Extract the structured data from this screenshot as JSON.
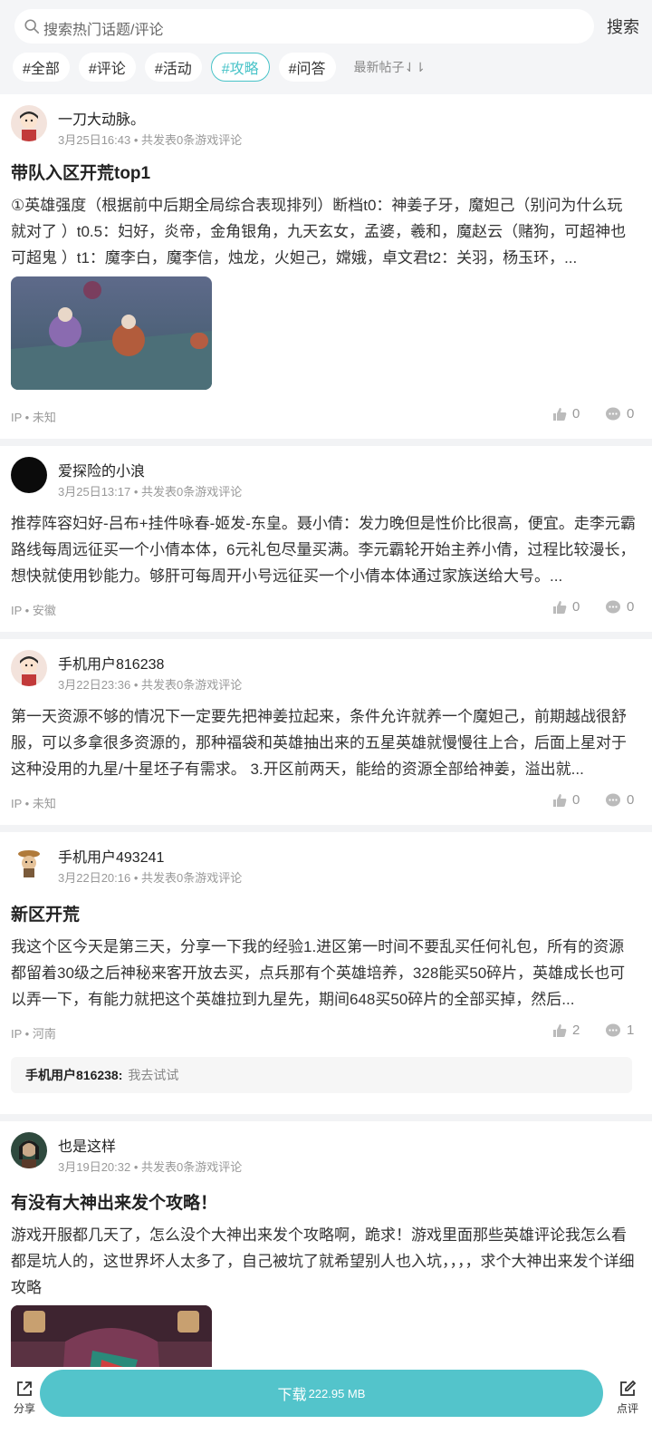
{
  "search": {
    "placeholder": "搜索热门话题/评论",
    "button": "搜索"
  },
  "filters": [
    {
      "label": "#全部"
    },
    {
      "label": "#评论"
    },
    {
      "label": "#活动"
    },
    {
      "label": "#攻略",
      "active": true
    },
    {
      "label": "#问答"
    }
  ],
  "sort_label": "最新帖子⇃⇂",
  "posts": [
    {
      "user": "一刀大动脉。",
      "meta": "3月25日16:43 • 共发表0条游戏评论",
      "title": "带队入区开荒top1",
      "body": "①英雄强度（根据前中后期全局综合表现排列）断档t0：神姜子牙，魔妲己（别问为什么玩就对了 ）t0.5：妇好，炎帝，金角银角，九天玄女，孟婆，羲和，魔赵云（赌狗，可超神也可超鬼 ）t1：魔李白，魔李信，烛龙，火妲己，嫦娥，卓文君t2：关羽，杨玉环，...",
      "ip": "IP • 未知",
      "likes": "0",
      "comments": "0"
    },
    {
      "user": "爱探险的小浪",
      "meta": "3月25日13:17 • 共发表0条游戏评论",
      "body": "推荐阵容妇好-吕布+挂件咏春-姬发-东皇。聂小倩：发力晚但是性价比很高，便宜。走李元霸路线每周远征买一个小倩本体，6元礼包尽量买满。李元霸轮开始主养小倩，过程比较漫长，想快就使用钞能力。够肝可每周开小号远征买一个小倩本体通过家族送给大号。...",
      "ip": "IP • 安徽",
      "likes": "0",
      "comments": "0"
    },
    {
      "user": "手机用户816238",
      "meta": "3月22日23:36 • 共发表0条游戏评论",
      "body": "第一天资源不够的情况下一定要先把神姜拉起来，条件允许就养一个魔妲己，前期越战很舒服，可以多拿很多资源的，那种福袋和英雄抽出来的五星英雄就慢慢往上合，后面上星对于这种没用的九星/十星坯子有需求。 3.开区前两天，能给的资源全部给神姜，溢出就...",
      "ip": "IP • 未知",
      "likes": "0",
      "comments": "0"
    },
    {
      "user": "手机用户493241",
      "meta": "3月22日20:16 • 共发表0条游戏评论",
      "title": "新区开荒",
      "body": "我这个区今天是第三天，分享一下我的经验1.进区第一时间不要乱买任何礼包，所有的资源都留着30级之后神秘来客开放去买，点兵那有个英雄培养，328能买50碎片，英雄成长也可以弄一下，有能力就把这个英雄拉到九星先，期间648买50碎片的全部买掉，然后...",
      "ip": "IP • 河南",
      "likes": "2",
      "comments": "1",
      "reply_user": "手机用户816238:",
      "reply_text": "我去试试"
    },
    {
      "user": "也是这样",
      "meta": "3月19日20:32 • 共发表0条游戏评论",
      "title": "有没有大神出来发个攻略！",
      "body": "游戏开服都几天了，怎么没个大神出来发个攻略啊，跪求！游戏里面那些英雄评论我怎么看都是坑人的，这世界坏人太多了，自己被坑了就希望别人也入坑，，，，求个大神出来发个详细攻略"
    }
  ],
  "bottom": {
    "share": "分享",
    "download": "下载",
    "size": "222.95 MB",
    "review": "点评"
  },
  "colors": {
    "accent": "#53c4cb",
    "chip_active": "#48c3c8"
  }
}
